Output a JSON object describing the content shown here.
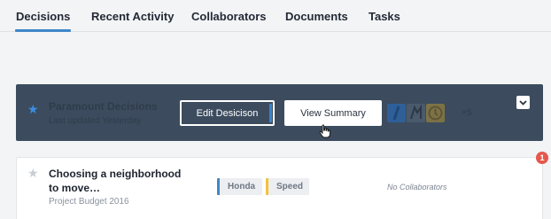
{
  "tabs": [
    {
      "label": "Decisions",
      "active": true
    },
    {
      "label": "Recent Activity",
      "active": false
    },
    {
      "label": "Collaborators",
      "active": false
    },
    {
      "label": "Documents",
      "active": false
    },
    {
      "label": "Tasks",
      "active": false
    }
  ],
  "featured": {
    "title": "Paramount Decisions",
    "subtitle": "Last updated Yesterday",
    "edit_label": "Edit Desicison",
    "view_label": "View Summary",
    "more_count": "+5",
    "starred": true
  },
  "decisions": [
    {
      "title": "Choosing a neighborhood to move…",
      "subtitle": "Project Budget 2016",
      "tags": [
        "Honda",
        "Speed"
      ],
      "collaborators_text": "No Collaborators",
      "notification_count": "1"
    }
  ],
  "colors": {
    "accent": "#3f86c9",
    "featured_bg": "#3c4c5e",
    "tag_blue": "#3f86c9",
    "tag_yellow": "#f2c33a",
    "badge": "#e5584c"
  }
}
